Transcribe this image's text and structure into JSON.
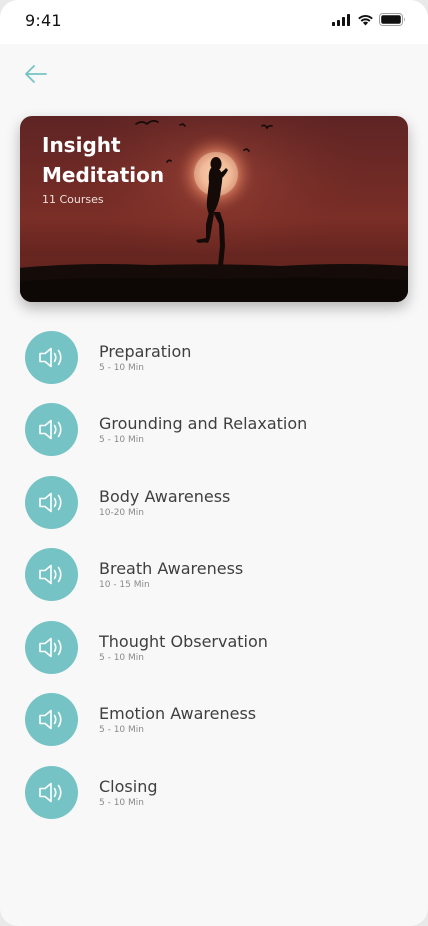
{
  "status_bar": {
    "time": "9:41"
  },
  "header": {
    "back_icon": "arrow-left-icon"
  },
  "hero": {
    "title": "Insight Meditation",
    "subtitle": "11 Courses"
  },
  "colors": {
    "accent": "#76c3c5",
    "text_primary": "#3f3f3f",
    "text_secondary": "#8a8a8a",
    "background": "#f8f8f8"
  },
  "courses": [
    {
      "title": "Preparation",
      "duration": "5 - 10 Min",
      "icon": "speaker-icon"
    },
    {
      "title": "Grounding and Relaxation",
      "duration": "5 - 10 Min",
      "icon": "speaker-icon"
    },
    {
      "title": "Body Awareness",
      "duration": "10-20 Min",
      "icon": "speaker-icon"
    },
    {
      "title": "Breath Awareness",
      "duration": "10 - 15 Min",
      "icon": "speaker-icon"
    },
    {
      "title": "Thought Observation",
      "duration": "5 - 10 Min",
      "icon": "speaker-icon"
    },
    {
      "title": "Emotion Awareness",
      "duration": "5 - 10 Min",
      "icon": "speaker-icon"
    },
    {
      "title": "Closing",
      "duration": "5 - 10 Min",
      "icon": "speaker-icon"
    }
  ]
}
